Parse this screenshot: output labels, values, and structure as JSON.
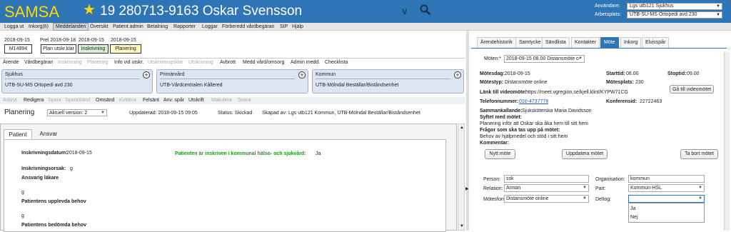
{
  "header": {
    "logo": "SAMSA",
    "patient": "19 280713-9163 Oskar Svensson",
    "user_label": "Användare:",
    "user_value": "Lgs utb121 Sjukhus",
    "workplace_label": "Arbetsplats:",
    "workplace_value": "UTB-SU-MS Ortopedi avd 230"
  },
  "menu": [
    "Logga ut",
    "Inkorg(6)",
    "Meddelanden",
    "Översikt",
    "Patient admin",
    "Betalning",
    "Rapporter",
    "Loggar",
    "Förberedd vårdbegäran",
    "SIP",
    "Hjälp"
  ],
  "status": {
    "d1": "2018-09-15",
    "box1": "M14994",
    "d2": "Prel 2018-09-18",
    "box2": "Plan utskr.klar",
    "d3": "2018-09-15",
    "box3": "Inskrivning",
    "d4": "2018-09-15",
    "box4": "Planering"
  },
  "toolbar1": [
    "Ärende",
    "Vårdbegäran",
    "Inskrivning",
    "Planering",
    "Info vid utskr.",
    "Utskrivningsklar",
    "Utskrivning",
    "Avbrott",
    "Medd vård/omsorg",
    "Admin medd.",
    "Checklista"
  ],
  "cards": [
    {
      "title": "Sjukhus",
      "value": "UTB-SU-MS Ortopedi avd 230"
    },
    {
      "title": "Primärvård",
      "value": "UTB-Vårdcentralen Kållered"
    },
    {
      "title": "Kommun",
      "value": "UTB-Mölndal Beställar/Biståndsenhet"
    }
  ],
  "toolbar2": [
    "Avbryt",
    "Redigera",
    "Spara",
    "SparaSänd",
    "Omsänd",
    "Kvittera",
    "Felsänt",
    "Anv. spår",
    "Utskrift",
    "Makulera",
    "Svara"
  ],
  "planering": {
    "title": "Planering",
    "version": "Aktuell version: 2",
    "updated": "Uppdaterad: 2018-09-15 09:05",
    "status": "Status: Skickad",
    "created": "Skapad av: Lgs utb121 Kommun, UTB-Mölndal Beställar/Biståndsenhet"
  },
  "tabs": [
    "Patient",
    "Ansvar"
  ],
  "patient": {
    "date_label": "Inskrivningsdatum:",
    "date": "2018-09-15",
    "green": "Patienten är inskriven i kommunal hälso- och sjukvård:",
    "green_val": "Ja",
    "reason_label": "Inskrivningsorsak:",
    "reason": "g",
    "doctor_label": "Ansvarig läkare",
    "doctor": "g",
    "needs_label": "Patientens upplevda behov",
    "needs": "g",
    "assessed_label": "Patientens bedömda behov"
  },
  "right_tabs": [
    "Ärendehistorik",
    "Samtycke",
    "Sändlista",
    "Kontakter",
    "Möte",
    "Inkorg",
    "Elvisspår"
  ],
  "meeting": {
    "select_label": "Möten:*",
    "select_value": "2018-09-15 08.00 Distansmöte o",
    "date_label": "Mötesdag:",
    "date": "2018-09-15",
    "type_label": "Mötestyp:",
    "type": "Distansmöte online",
    "start_label": "Starttid:",
    "start": "08.00",
    "place_label": "Mötesplats:",
    "place": "230",
    "stop_label": "Stoptid:",
    "stop": "09.00",
    "link_label": "Länk till videomöte:",
    "link": "https://meet.vgregion.se/kjell.klint/KYPW71CG",
    "go_btn": "Gå till videomötet",
    "phone_label": "Telefonnummer:",
    "phone": "010-4737778",
    "conf_label": "Konferensid:",
    "conf": "22722463",
    "caller_label": "Sammankallande:",
    "caller": "Sjuksköterska Maria Davidsson",
    "purpose_label": "Syftet med mötet:",
    "purpose": "Planering inför att Oskar ska åka hem till sitt hem",
    "questions_label": "Frågor som ska tas upp på mötet:",
    "questions": "Behov av hjälpmedel och stöd i sitt hem",
    "comment_label": "Kommentar:",
    "new_btn": "Nytt möte",
    "update_btn": "Uppdatera mötet",
    "delete_btn": "Ta bort mötet"
  },
  "participant": {
    "person_label": "Person:",
    "person": "ssk",
    "org_label": "Organisation:",
    "org": "kommun",
    "rel_label": "Relation:",
    "rel": "Annan",
    "part_label": "Part:",
    "part": "Kommun-HSL",
    "form_label": "Mötesform:",
    "form": "Distansmöte online",
    "att_label": "Deltog:",
    "att": "",
    "options": [
      "Ja",
      "Nej"
    ]
  }
}
